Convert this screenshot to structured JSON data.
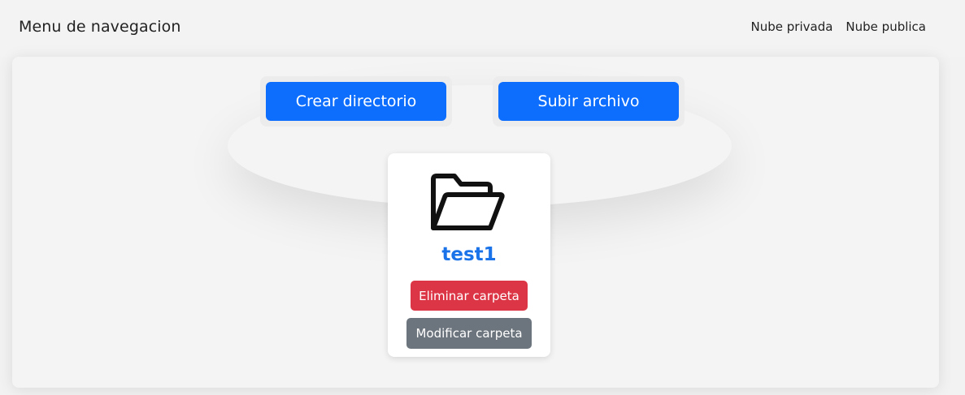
{
  "header": {
    "brand": "Menu de navegacion",
    "nav": [
      {
        "label": "Nube privada"
      },
      {
        "label": "Nube publica"
      }
    ]
  },
  "actions": {
    "create_dir_label": "Crear directorio",
    "upload_file_label": "Subir archivo"
  },
  "folders": [
    {
      "name": "test1",
      "icon": "folder-open-icon",
      "delete_label": "Eliminar carpeta",
      "modify_label": "Modificar carpeta"
    }
  ],
  "colors": {
    "primary": "#0d6efd",
    "danger": "#dc3545",
    "secondary": "#6c757d",
    "folder_title": "#1a73e8"
  }
}
